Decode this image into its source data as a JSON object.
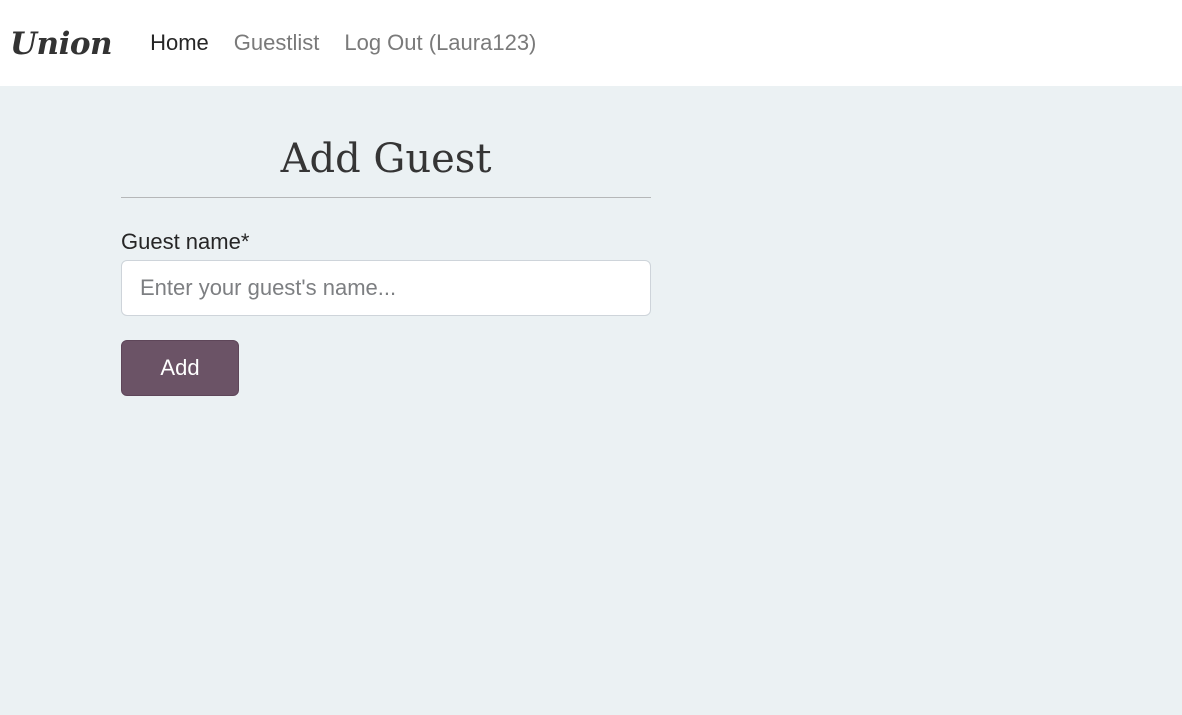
{
  "navbar": {
    "brand": "Union",
    "links": {
      "home": "Home",
      "guestlist": "Guestlist",
      "logout": "Log Out (Laura123)"
    }
  },
  "main": {
    "title": "Add Guest",
    "guest_name_label": "Guest name*",
    "guest_name_placeholder": "Enter your guest's name...",
    "guest_name_value": "",
    "add_button_label": "Add"
  },
  "colors": {
    "page_background": "#ebf1f3",
    "navbar_background": "#ffffff",
    "button_accent": "#6b5366"
  }
}
